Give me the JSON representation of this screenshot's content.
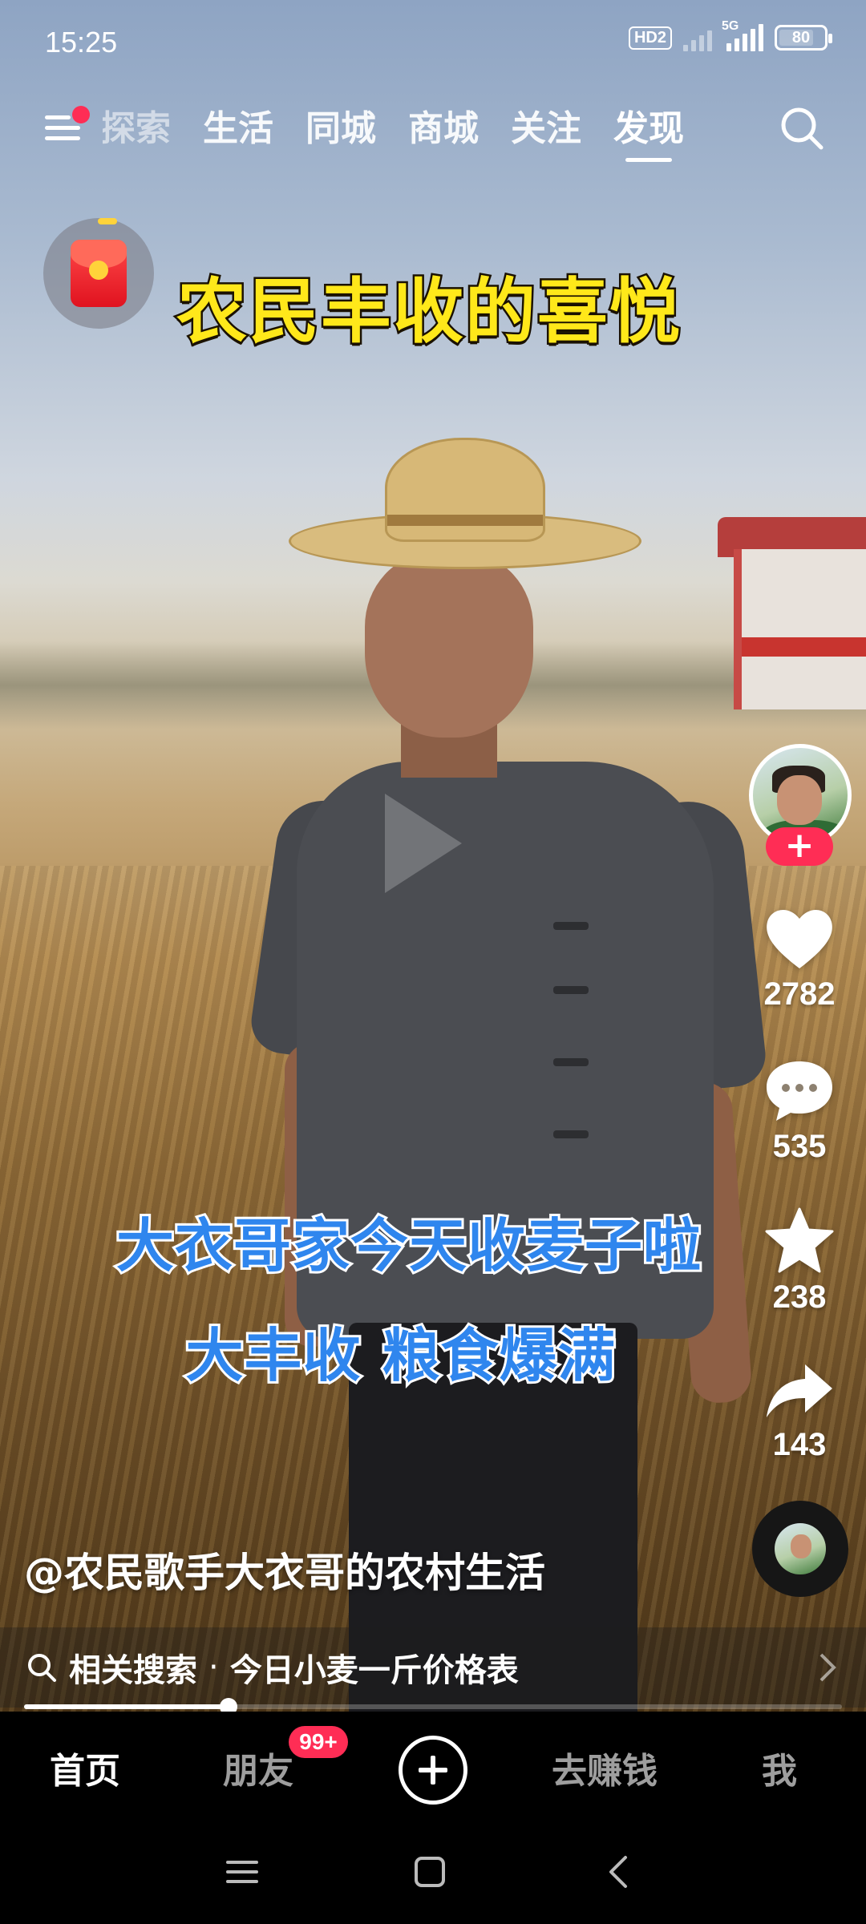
{
  "status_bar": {
    "time": "15:25",
    "hd_label": "HD2",
    "network_label": "5G",
    "battery": "80",
    "battery_level": 0.8
  },
  "top_nav": {
    "tabs": [
      {
        "label": "探索",
        "state": "partial"
      },
      {
        "label": "生活"
      },
      {
        "label": "同城"
      },
      {
        "label": "商城"
      },
      {
        "label": "关注"
      },
      {
        "label": "发现",
        "active": true
      }
    ],
    "menu_icon": "menu-icon",
    "menu_has_dot": true,
    "search_icon": "search-icon"
  },
  "video": {
    "title": "农民丰收的喜悦",
    "subtitle_line1": "大衣哥家今天收麦子啦",
    "subtitle_line2": "大丰收 粮食爆满",
    "title_color": "#ffe81a",
    "subtitle_color": "#2f86ee"
  },
  "actions": {
    "follow_label": "+",
    "likes": "2782",
    "comments": "535",
    "favorites": "238",
    "shares": "143"
  },
  "author": {
    "handle": "@农民歌手大衣哥的农村生活"
  },
  "related_search": {
    "label": "相关搜索",
    "separator": "·",
    "query": "今日小麦一斤价格表"
  },
  "playback": {
    "progress": 0.25
  },
  "tab_bar": {
    "home": "首页",
    "friends": "朋友",
    "friends_badge": "99+",
    "earn": "去赚钱",
    "me": "我"
  },
  "colors": {
    "accent": "#ff2d55",
    "tab_bar_bg": "#000000"
  }
}
